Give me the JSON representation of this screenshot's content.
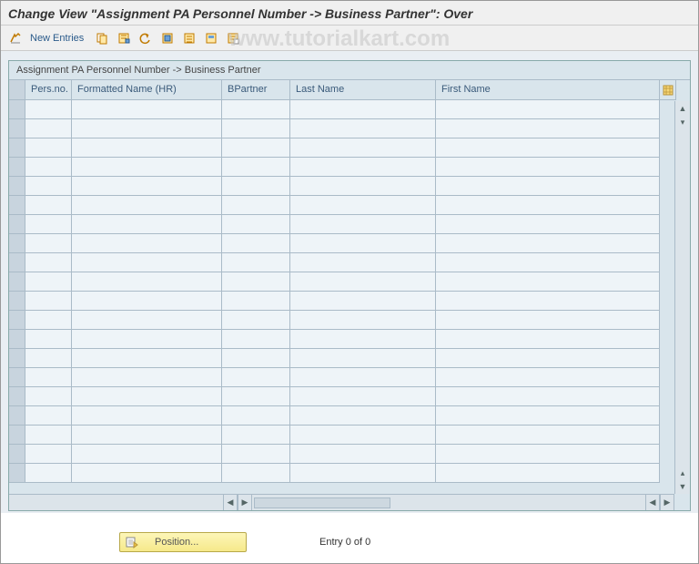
{
  "title": "Change View \"Assignment PA Personnel Number -> Business Partner\": Over",
  "watermark": "www.tutorialkart.com",
  "toolbar": {
    "new_entries_label": "New Entries"
  },
  "grid": {
    "caption": "Assignment PA Personnel Number -> Business Partner",
    "columns": [
      "Pers.no.",
      "Formatted Name (HR)",
      "BPartner",
      "Last Name",
      "First Name"
    ],
    "row_count": 20
  },
  "footer": {
    "position_label": "Position...",
    "entry_text": "Entry 0 of 0"
  }
}
